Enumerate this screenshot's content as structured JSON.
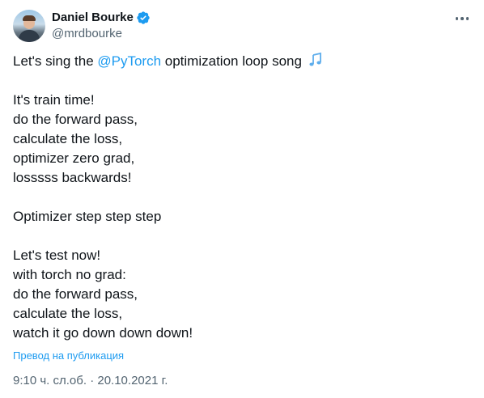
{
  "author": {
    "display_name": "Daniel Bourke",
    "handle": "@mrdbourke",
    "verified": true,
    "verified_color": "#1d9bf0"
  },
  "tweet": {
    "intro_before": "Let's sing the ",
    "mention": "@PyTorch",
    "intro_after": " optimization loop song ",
    "intro_emoji": "musical-notes-icon",
    "stanza1": [
      "It's train time!",
      "do the forward pass,",
      "calculate the loss,",
      "optimizer zero grad,",
      "losssss backwards!"
    ],
    "stanza2": [
      "Optimizer step step step"
    ],
    "stanza3": [
      "Let's test now!",
      "with torch no grad:",
      "do the forward pass,",
      "calculate the loss,",
      "watch it go down down down!"
    ]
  },
  "translate_label": "Превод на публикация",
  "timestamp": "9:10 ч. сл.об. · 20.10.2021 г.",
  "colors": {
    "text": "#0f1419",
    "secondary": "#536471",
    "link": "#1d9bf0"
  }
}
